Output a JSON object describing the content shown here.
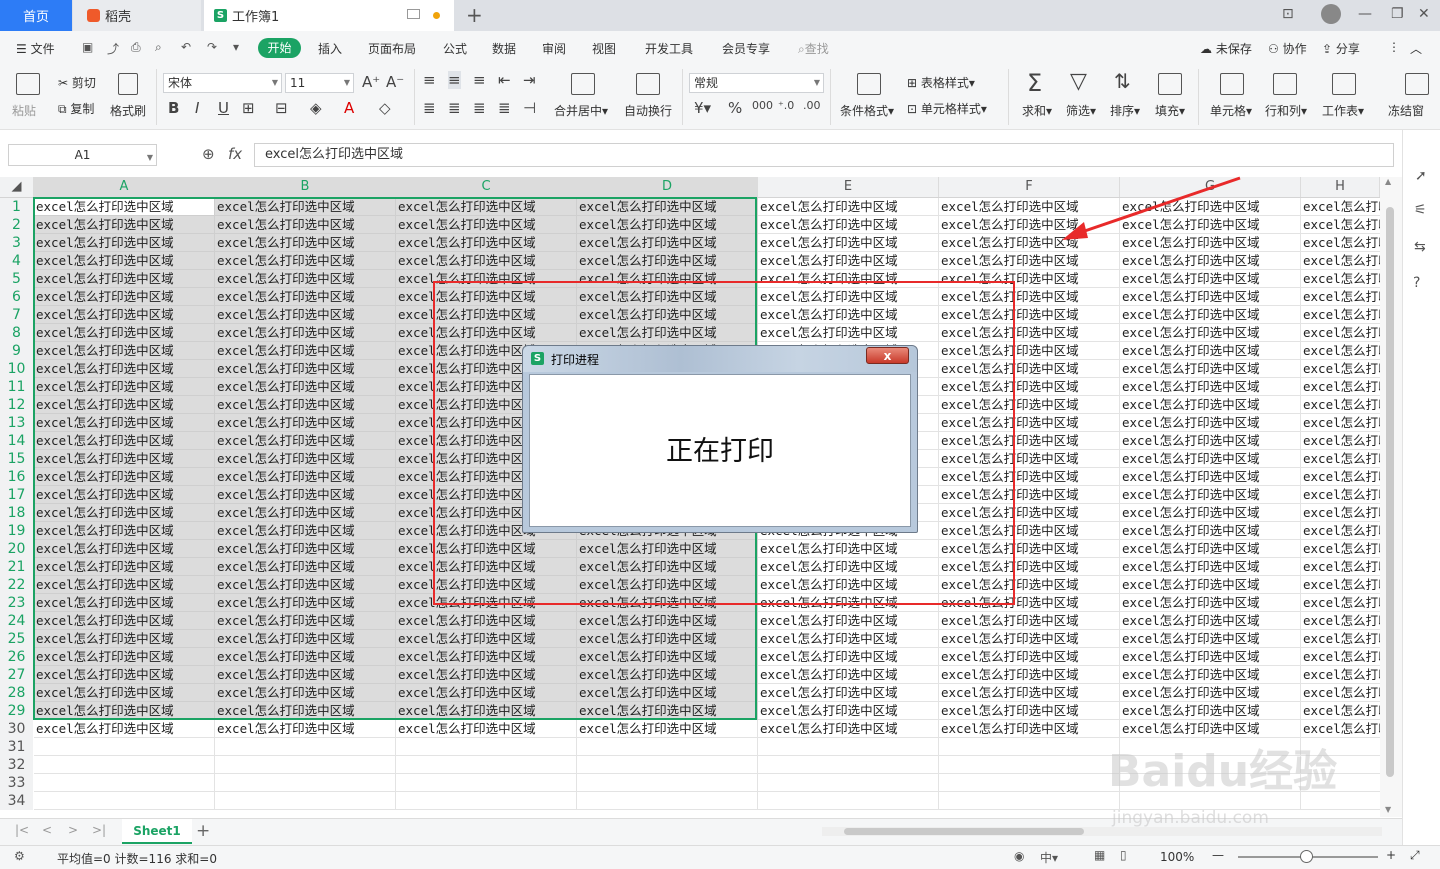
{
  "tabs": {
    "home": "首页",
    "daoke": "稻壳",
    "workbook": "工作簿1"
  },
  "menu": {
    "file": "文件",
    "items": [
      "开始",
      "插入",
      "页面布局",
      "公式",
      "数据",
      "审阅",
      "视图",
      "开发工具",
      "会员专享"
    ],
    "search": "查找",
    "unsaved": "未保存",
    "collab": "协作",
    "share": "分享"
  },
  "ribbon": {
    "paste": "粘贴",
    "cut": "剪切",
    "copy": "复制",
    "format_painter": "格式刷",
    "font_name": "宋体",
    "font_size": "11",
    "merge_center": "合并居中",
    "wrap_text": "自动换行",
    "number_format": "常规",
    "cond_format": "条件格式",
    "table_style": "表格样式",
    "cell_style": "单元格样式",
    "sum": "求和",
    "filter": "筛选",
    "sort": "排序",
    "fill": "填充",
    "cell": "单元格",
    "row_col": "行和列",
    "worksheet": "工作表",
    "freeze": "冻结窗"
  },
  "formula_bar": {
    "name_box": "A1",
    "fx": "fx",
    "content": "excel怎么打印选中区域"
  },
  "columns": [
    "A",
    "B",
    "C",
    "D",
    "E",
    "F",
    "G",
    "H"
  ],
  "rows": [
    "1",
    "2",
    "3",
    "4",
    "5",
    "6",
    "7",
    "8",
    "9",
    "10",
    "11",
    "12",
    "13",
    "14",
    "15",
    "16",
    "17",
    "18",
    "19",
    "20",
    "21",
    "22",
    "23",
    "24",
    "25",
    "26",
    "27",
    "28",
    "29",
    "30",
    "31",
    "32",
    "33",
    "34"
  ],
  "cell_text": "excel怎么打印选中区域",
  "filled_rows": 30,
  "selection": {
    "range": "A1:D29"
  },
  "dialog": {
    "title": "打印进程",
    "message": "正在打印",
    "close": "x"
  },
  "sheet_tab": "Sheet1",
  "status": {
    "text": "平均值=0  计数=116  求和=0",
    "zoom": "100%"
  },
  "watermark": {
    "logo": "Baidu经验",
    "url": "jingyan.baidu.com"
  },
  "colors": {
    "accent_green": "#1ba364",
    "tab_blue": "#2d7cf6",
    "annotation_red": "#e82a2a"
  }
}
